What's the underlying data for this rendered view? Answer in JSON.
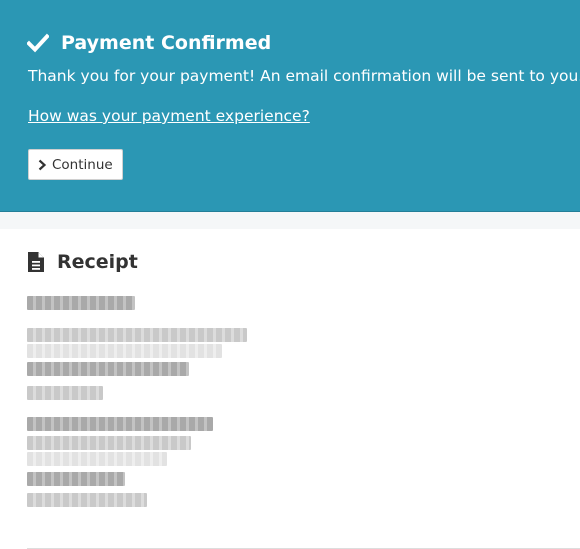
{
  "confirmation": {
    "title": "Payment Confirmed",
    "message": "Thank you for your payment! An email confirmation will be sent to you.",
    "feedback_link": "How was your payment experience?",
    "continue_label": "Continue",
    "icon": "checkmark-icon",
    "banner_color": "#2b97b4"
  },
  "receipt": {
    "title": "Receipt",
    "icon": "document-icon",
    "redacted_lines": 10
  }
}
